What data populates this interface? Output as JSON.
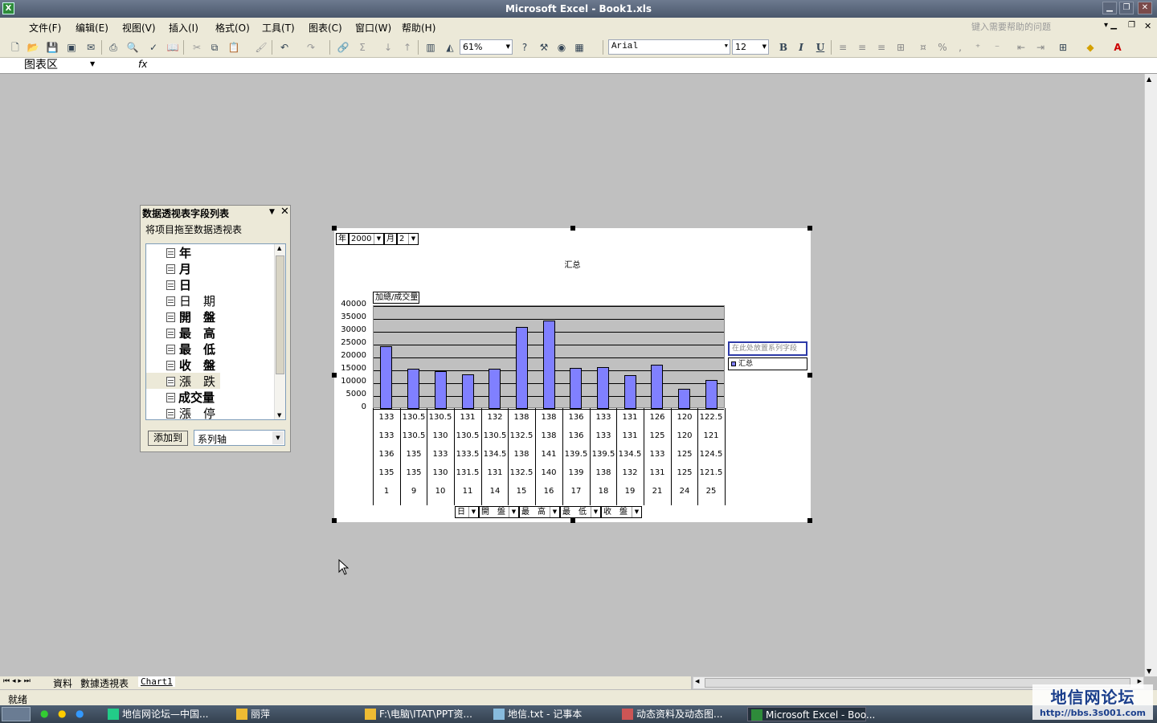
{
  "window": {
    "title": "Microsoft Excel - Book1.xls"
  },
  "menu": {
    "items": [
      "文件(F)",
      "编辑(E)",
      "视图(V)",
      "插入(I)",
      "格式(O)",
      "工具(T)",
      "图表(C)",
      "窗口(W)",
      "帮助(H)"
    ],
    "help_placeholder": "键入需要帮助的问题"
  },
  "toolbar": {
    "zoom": "61%",
    "font": "Arial",
    "size": "12",
    "bold": "B",
    "italic": "I",
    "underline": "U"
  },
  "formula": {
    "namebox": "图表区",
    "fx": "fx"
  },
  "fieldlist": {
    "title": "数据透视表字段列表",
    "instruction": "将项目拖至数据透视表",
    "fields": [
      "年",
      "月",
      "日",
      "日　期",
      "開　盤",
      "最　高",
      "最　低",
      "收　盤",
      "漲　跌",
      "成交量",
      "漲　停"
    ],
    "add_button": "添加到",
    "area_select": "系列轴"
  },
  "chart": {
    "page_fields": [
      {
        "label": "年",
        "value": "2000"
      },
      {
        "label": "月",
        "value": "2"
      }
    ],
    "title": "汇总",
    "data_field": "加總/成交量",
    "series_drop": "在此处放置系列字段",
    "row_fields": [
      "日",
      "開　盤",
      "最　高",
      "最　低",
      "收　盤"
    ]
  },
  "chart_data": {
    "type": "bar",
    "title": "汇总",
    "ylim": [
      0,
      40000
    ],
    "yticks": [
      "40000",
      "35000",
      "30000",
      "25000",
      "20000",
      "15000",
      "10000",
      "5000",
      "0"
    ],
    "legend": "汇总",
    "series": [
      {
        "name": "汇总",
        "values": [
          24500,
          15500,
          14800,
          13500,
          15500,
          32000,
          34500,
          15800,
          16200,
          13200,
          17200,
          7800,
          11200
        ]
      }
    ],
    "category_rows": [
      [
        "133",
        "130.5",
        "130.5",
        "131",
        "132",
        "138",
        "138",
        "136",
        "133",
        "131",
        "126",
        "120",
        "122.5"
      ],
      [
        "133",
        "130.5",
        "130",
        "130.5",
        "130.5",
        "132.5",
        "138",
        "136",
        "133",
        "131",
        "125",
        "120",
        "121"
      ],
      [
        "136",
        "135",
        "133",
        "133.5",
        "134.5",
        "138",
        "141",
        "139.5",
        "139.5",
        "134.5",
        "133",
        "125",
        "124.5"
      ],
      [
        "135",
        "135",
        "130",
        "131.5",
        "131",
        "132.5",
        "140",
        "139",
        "138",
        "132",
        "131",
        "125",
        "121.5"
      ],
      [
        "1",
        "9",
        "10",
        "11",
        "14",
        "15",
        "16",
        "17",
        "18",
        "19",
        "21",
        "24",
        "25"
      ]
    ]
  },
  "sheets": {
    "tabs": [
      "資料",
      "數據透視表",
      "Chart1"
    ]
  },
  "status": {
    "text": "就绪"
  },
  "taskbar": {
    "tasks": [
      "地信网论坛—中国...",
      "丽萍",
      "F:\\电脑\\ITAT\\PPT资...",
      "地信.txt - 记事本",
      "动态资料及动态图...",
      "Microsoft Excel - Boo..."
    ]
  },
  "watermark": {
    "name": "地信网论坛",
    "url": "http://bbs.3s001.com"
  },
  "colors": {
    "bar": "#8080ff",
    "plot": "#c0c0c0",
    "legend_border": "#2d3aa8"
  }
}
